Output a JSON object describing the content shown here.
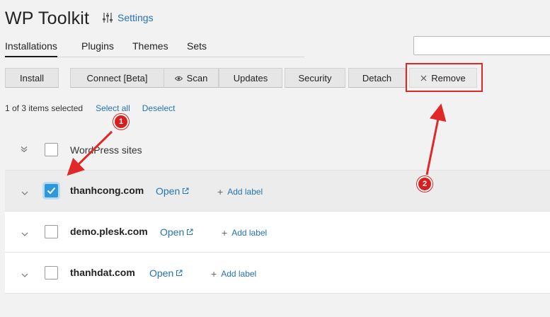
{
  "app": {
    "title": "WP Toolkit",
    "settings_label": "Settings"
  },
  "tabs": [
    {
      "label": "Installations",
      "active": true
    },
    {
      "label": "Plugins",
      "active": false
    },
    {
      "label": "Themes",
      "active": false
    },
    {
      "label": "Sets",
      "active": false
    }
  ],
  "search": {
    "value": "",
    "placeholder": ""
  },
  "toolbar": {
    "install": "Install",
    "connect": "Connect [Beta]",
    "scan": "Scan",
    "updates": "Updates",
    "security": "Security",
    "detach": "Detach",
    "remove": "Remove"
  },
  "selection": {
    "count_text": "1 of 3 items selected",
    "select_all": "Select all",
    "deselect": "Deselect"
  },
  "group": {
    "label": "WordPress sites"
  },
  "sites": [
    {
      "name": "thanhcong.com",
      "open": "Open",
      "add_label": "Add label",
      "checked": true
    },
    {
      "name": "demo.plesk.com",
      "open": "Open",
      "add_label": "Add label",
      "checked": false
    },
    {
      "name": "thanhdat.com",
      "open": "Open",
      "add_label": "Add label",
      "checked": false
    }
  ],
  "annotations": {
    "badge_1": "1",
    "badge_2": "2"
  },
  "colors": {
    "link": "#2473b5",
    "annotation_red": "#e02828",
    "checkbox_blue": "#2f97de"
  }
}
